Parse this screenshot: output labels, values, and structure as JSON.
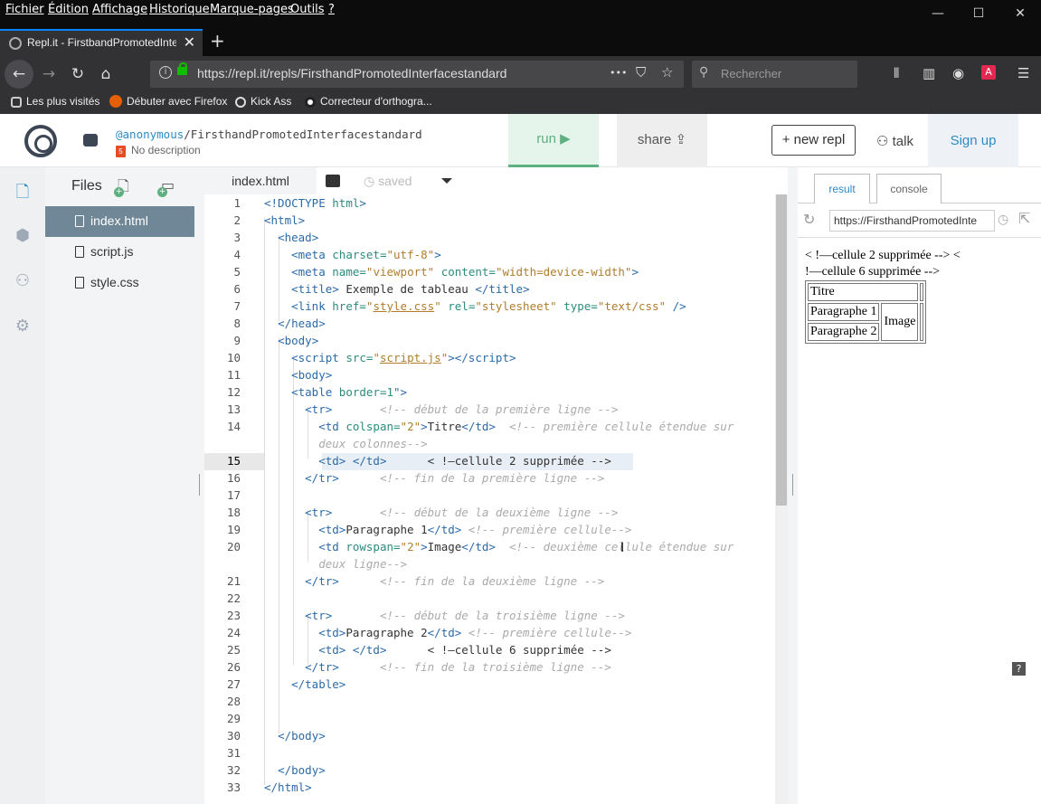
{
  "menubar": {
    "items": [
      "Fichier",
      "Édition",
      "Affichage",
      "Historique",
      "Marque-pages",
      "Outils",
      "?"
    ]
  },
  "window_controls": {
    "minimize": "—",
    "maximize": "☐",
    "close": "✕"
  },
  "tab": {
    "title": "Repl.it - FirstbandPromotedInte",
    "close": "✕",
    "new_tab": "+"
  },
  "navbar": {
    "url": "https://repl.it/repls/FirsthandPromotedInterfacestandard",
    "search_placeholder": "Rechercher",
    "more": "•••"
  },
  "bookmarks": [
    "Les plus visités",
    "Débuter avec Firefox",
    "Kick Ass",
    "Correcteur d'orthogra..."
  ],
  "repl": {
    "user": "@anonymous",
    "repl_name": "/FirsthandPromotedInterfacestandard",
    "description": "No description",
    "run_label": "run ▶",
    "share_label": "share",
    "new_repl_label": "+ new repl",
    "talk_label": "talk",
    "signup_label": "Sign up"
  },
  "files": {
    "title": "Files",
    "items": [
      {
        "name": "index.html",
        "active": true
      },
      {
        "name": "script.js",
        "active": false
      },
      {
        "name": "style.css",
        "active": false
      }
    ]
  },
  "editor": {
    "active_tab": "index.html",
    "saved_label": "saved"
  },
  "result_panel": {
    "tab_result": "result",
    "tab_console": "console",
    "url": "https://FirsthandPromotedInte",
    "text_line1": "< !—cellule 2 supprimée --> <",
    "text_line2": "!—cellule 6 supprimée -->",
    "cell_titre": "Titre",
    "cell_p1": "Paragraphe 1",
    "cell_image": "Image",
    "cell_p2": "Paragraphe 2"
  },
  "help": "?",
  "colors": {
    "accent": "#2c8bc6",
    "run": "#5db07f",
    "firefox_dark": "#0c0c0d"
  }
}
